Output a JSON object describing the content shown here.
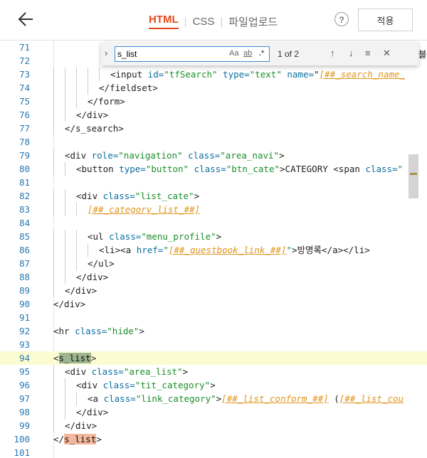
{
  "tabs": [
    {
      "label": "HTML",
      "active": true
    },
    {
      "label": "CSS",
      "active": false
    },
    {
      "label": "파일업로드",
      "active": false
    }
  ],
  "apply_label": "적용",
  "help_label": "?",
  "find": {
    "query": "s_list",
    "match_case": "Aa",
    "whole_word": "ab",
    "regex": ".*",
    "count": "1 of 2"
  },
  "partial_text_behind_find": "블로그",
  "lines": [
    {
      "n": "71",
      "code": ""
    },
    {
      "n": "72",
      "code": ""
    },
    {
      "n": "73",
      "code": "<input id=\"tfSearch\" type=\"text\" name=\"[##_search_name_"
    },
    {
      "n": "74",
      "code": "</fieldset>"
    },
    {
      "n": "75",
      "code": "</form>"
    },
    {
      "n": "76",
      "code": "</div>"
    },
    {
      "n": "77",
      "code": "</s_search>"
    },
    {
      "n": "78",
      "code": ""
    },
    {
      "n": "79",
      "code": "<div role=\"navigation\" class=\"area_navi\">"
    },
    {
      "n": "80",
      "code": "<button type=\"button\" class=\"btn_cate\">CATEGORY <span class=\""
    },
    {
      "n": "81",
      "code": ""
    },
    {
      "n": "82",
      "code": "<div class=\"list_cate\">"
    },
    {
      "n": "83",
      "code": "[##_category_list_##]"
    },
    {
      "n": "84",
      "code": ""
    },
    {
      "n": "85",
      "code": "<ul class=\"menu_profile\">"
    },
    {
      "n": "86",
      "code": "<li><a href=\"[##_guestbook_link_##]\">방명록</a></li>"
    },
    {
      "n": "87",
      "code": "</ul>"
    },
    {
      "n": "88",
      "code": "</div>"
    },
    {
      "n": "89",
      "code": "</div>"
    },
    {
      "n": "90",
      "code": "</div>"
    },
    {
      "n": "91",
      "code": ""
    },
    {
      "n": "92",
      "code": "<hr class=\"hide\">"
    },
    {
      "n": "93",
      "code": ""
    },
    {
      "n": "94",
      "code": "<s_list>"
    },
    {
      "n": "95",
      "code": "<div class=\"area_list\">"
    },
    {
      "n": "96",
      "code": "<div class=\"tit_category\">"
    },
    {
      "n": "97",
      "code": "<a class=\"link_category\">[##_list_conform_##] ([##_list_cou"
    },
    {
      "n": "98",
      "code": "</div>"
    },
    {
      "n": "99",
      "code": "</div>"
    },
    {
      "n": "100",
      "code": "</s_list>"
    },
    {
      "n": "101",
      "code": ""
    }
  ]
}
